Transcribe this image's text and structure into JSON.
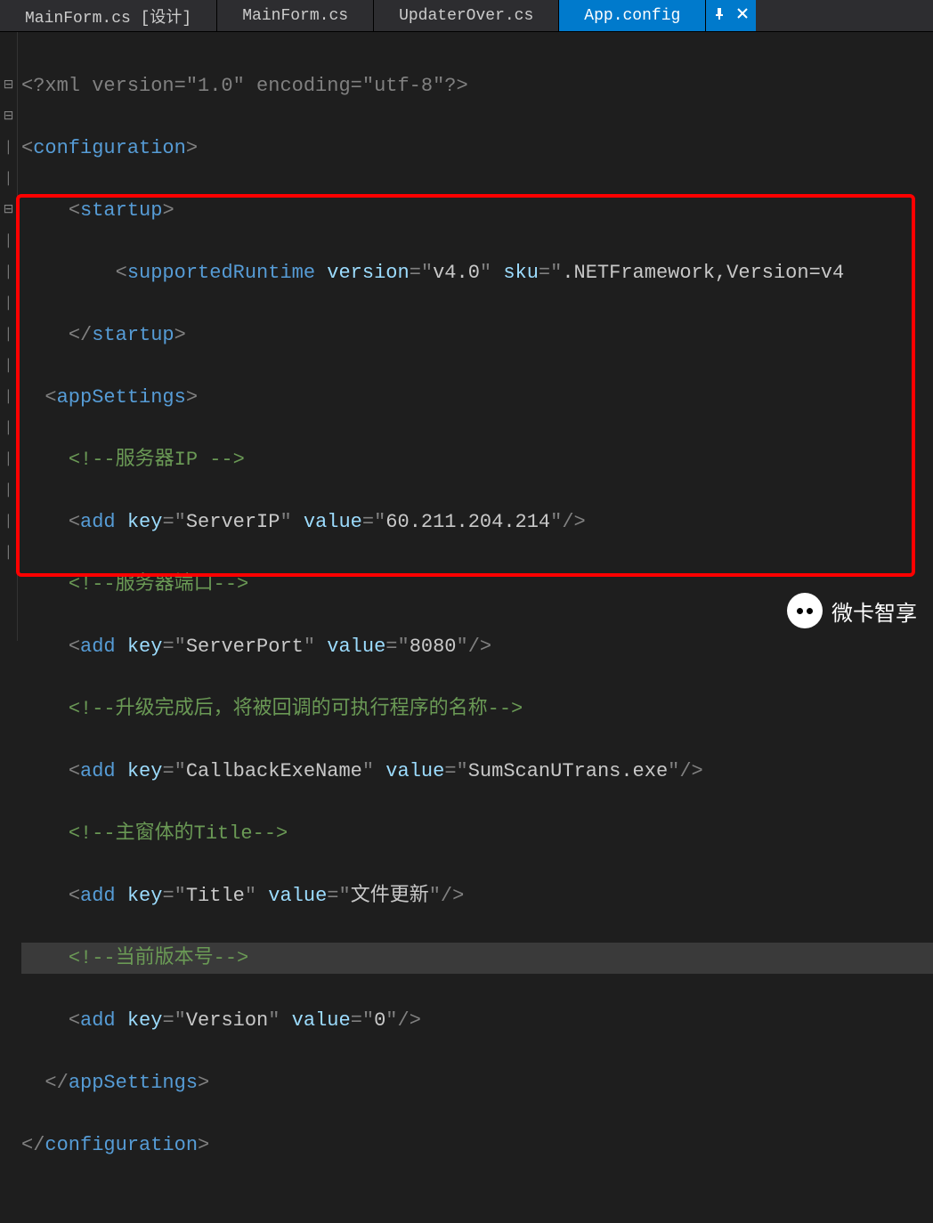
{
  "tabs": [
    {
      "label": "MainForm.cs [设计]"
    },
    {
      "label": "MainForm.cs"
    },
    {
      "label": "UpdaterOver.cs"
    },
    {
      "label": "App.config"
    }
  ],
  "code": {
    "xml_decl": "<?xml version=\"1.0\" encoding=\"utf-8\"?>",
    "config_open": "configuration",
    "startup_open": "startup",
    "supportedRuntime": {
      "tag": "supportedRuntime",
      "version": "v4.0",
      "sku": ".NETFramework,Version=v4"
    },
    "startup_close": "startup",
    "appSettings_open": "appSettings",
    "c1": "服务器IP ",
    "add1": {
      "key": "ServerIP",
      "value": "60.211.204.214"
    },
    "c2": "服务器端口",
    "add2": {
      "key": "ServerPort",
      "value": "8080"
    },
    "c3": "升级完成后，将被回调的可执行程序的名称",
    "add3": {
      "key": "CallbackExeName",
      "value": "SumScanUTrans.exe"
    },
    "c4": "主窗体的Title",
    "add4": {
      "key": "Title",
      "value": "文件更新"
    },
    "c5": "当前版本号",
    "add5": {
      "key": "Version",
      "value": "0"
    },
    "appSettings_close": "appSettings",
    "config_close": "configuration"
  },
  "watermark": "微卡智享"
}
